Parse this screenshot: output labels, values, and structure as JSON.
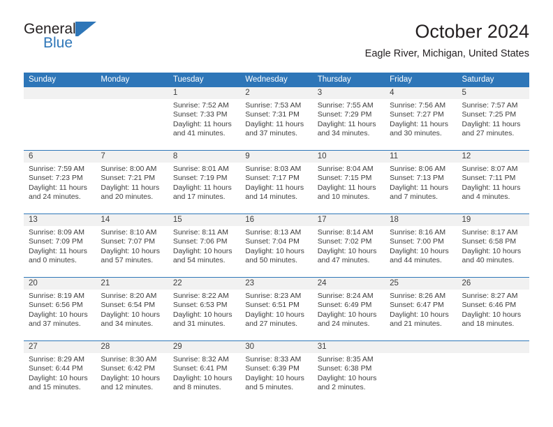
{
  "brand": {
    "word_general": "General",
    "word_blue": "Blue",
    "logo_color": "#2e76b8"
  },
  "header": {
    "month_title": "October 2024",
    "location": "Eagle River, Michigan, United States"
  },
  "theme": {
    "header_blue": "#2e76b8",
    "daynum_band": "#f1f1f1",
    "text": "#3d3d3d",
    "title_text": "#231f20"
  },
  "weekdays": [
    "Sunday",
    "Monday",
    "Tuesday",
    "Wednesday",
    "Thursday",
    "Friday",
    "Saturday"
  ],
  "labels": {
    "sunrise_prefix": "Sunrise:",
    "sunset_prefix": "Sunset:",
    "daylight_prefix": "Daylight:"
  },
  "weeks": [
    [
      {
        "day": "",
        "sunrise": "",
        "sunset": "",
        "daylight": "",
        "empty": true
      },
      {
        "day": "",
        "sunrise": "",
        "sunset": "",
        "daylight": "",
        "empty": true
      },
      {
        "day": "1",
        "sunrise": "Sunrise: 7:52 AM",
        "sunset": "Sunset: 7:33 PM",
        "daylight": "Daylight: 11 hours and 41 minutes.",
        "empty": false
      },
      {
        "day": "2",
        "sunrise": "Sunrise: 7:53 AM",
        "sunset": "Sunset: 7:31 PM",
        "daylight": "Daylight: 11 hours and 37 minutes.",
        "empty": false
      },
      {
        "day": "3",
        "sunrise": "Sunrise: 7:55 AM",
        "sunset": "Sunset: 7:29 PM",
        "daylight": "Daylight: 11 hours and 34 minutes.",
        "empty": false
      },
      {
        "day": "4",
        "sunrise": "Sunrise: 7:56 AM",
        "sunset": "Sunset: 7:27 PM",
        "daylight": "Daylight: 11 hours and 30 minutes.",
        "empty": false
      },
      {
        "day": "5",
        "sunrise": "Sunrise: 7:57 AM",
        "sunset": "Sunset: 7:25 PM",
        "daylight": "Daylight: 11 hours and 27 minutes.",
        "empty": false
      }
    ],
    [
      {
        "day": "6",
        "sunrise": "Sunrise: 7:59 AM",
        "sunset": "Sunset: 7:23 PM",
        "daylight": "Daylight: 11 hours and 24 minutes.",
        "empty": false
      },
      {
        "day": "7",
        "sunrise": "Sunrise: 8:00 AM",
        "sunset": "Sunset: 7:21 PM",
        "daylight": "Daylight: 11 hours and 20 minutes.",
        "empty": false
      },
      {
        "day": "8",
        "sunrise": "Sunrise: 8:01 AM",
        "sunset": "Sunset: 7:19 PM",
        "daylight": "Daylight: 11 hours and 17 minutes.",
        "empty": false
      },
      {
        "day": "9",
        "sunrise": "Sunrise: 8:03 AM",
        "sunset": "Sunset: 7:17 PM",
        "daylight": "Daylight: 11 hours and 14 minutes.",
        "empty": false
      },
      {
        "day": "10",
        "sunrise": "Sunrise: 8:04 AM",
        "sunset": "Sunset: 7:15 PM",
        "daylight": "Daylight: 11 hours and 10 minutes.",
        "empty": false
      },
      {
        "day": "11",
        "sunrise": "Sunrise: 8:06 AM",
        "sunset": "Sunset: 7:13 PM",
        "daylight": "Daylight: 11 hours and 7 minutes.",
        "empty": false
      },
      {
        "day": "12",
        "sunrise": "Sunrise: 8:07 AM",
        "sunset": "Sunset: 7:11 PM",
        "daylight": "Daylight: 11 hours and 4 minutes.",
        "empty": false
      }
    ],
    [
      {
        "day": "13",
        "sunrise": "Sunrise: 8:09 AM",
        "sunset": "Sunset: 7:09 PM",
        "daylight": "Daylight: 11 hours and 0 minutes.",
        "empty": false
      },
      {
        "day": "14",
        "sunrise": "Sunrise: 8:10 AM",
        "sunset": "Sunset: 7:07 PM",
        "daylight": "Daylight: 10 hours and 57 minutes.",
        "empty": false
      },
      {
        "day": "15",
        "sunrise": "Sunrise: 8:11 AM",
        "sunset": "Sunset: 7:06 PM",
        "daylight": "Daylight: 10 hours and 54 minutes.",
        "empty": false
      },
      {
        "day": "16",
        "sunrise": "Sunrise: 8:13 AM",
        "sunset": "Sunset: 7:04 PM",
        "daylight": "Daylight: 10 hours and 50 minutes.",
        "empty": false
      },
      {
        "day": "17",
        "sunrise": "Sunrise: 8:14 AM",
        "sunset": "Sunset: 7:02 PM",
        "daylight": "Daylight: 10 hours and 47 minutes.",
        "empty": false
      },
      {
        "day": "18",
        "sunrise": "Sunrise: 8:16 AM",
        "sunset": "Sunset: 7:00 PM",
        "daylight": "Daylight: 10 hours and 44 minutes.",
        "empty": false
      },
      {
        "day": "19",
        "sunrise": "Sunrise: 8:17 AM",
        "sunset": "Sunset: 6:58 PM",
        "daylight": "Daylight: 10 hours and 40 minutes.",
        "empty": false
      }
    ],
    [
      {
        "day": "20",
        "sunrise": "Sunrise: 8:19 AM",
        "sunset": "Sunset: 6:56 PM",
        "daylight": "Daylight: 10 hours and 37 minutes.",
        "empty": false
      },
      {
        "day": "21",
        "sunrise": "Sunrise: 8:20 AM",
        "sunset": "Sunset: 6:54 PM",
        "daylight": "Daylight: 10 hours and 34 minutes.",
        "empty": false
      },
      {
        "day": "22",
        "sunrise": "Sunrise: 8:22 AM",
        "sunset": "Sunset: 6:53 PM",
        "daylight": "Daylight: 10 hours and 31 minutes.",
        "empty": false
      },
      {
        "day": "23",
        "sunrise": "Sunrise: 8:23 AM",
        "sunset": "Sunset: 6:51 PM",
        "daylight": "Daylight: 10 hours and 27 minutes.",
        "empty": false
      },
      {
        "day": "24",
        "sunrise": "Sunrise: 8:24 AM",
        "sunset": "Sunset: 6:49 PM",
        "daylight": "Daylight: 10 hours and 24 minutes.",
        "empty": false
      },
      {
        "day": "25",
        "sunrise": "Sunrise: 8:26 AM",
        "sunset": "Sunset: 6:47 PM",
        "daylight": "Daylight: 10 hours and 21 minutes.",
        "empty": false
      },
      {
        "day": "26",
        "sunrise": "Sunrise: 8:27 AM",
        "sunset": "Sunset: 6:46 PM",
        "daylight": "Daylight: 10 hours and 18 minutes.",
        "empty": false
      }
    ],
    [
      {
        "day": "27",
        "sunrise": "Sunrise: 8:29 AM",
        "sunset": "Sunset: 6:44 PM",
        "daylight": "Daylight: 10 hours and 15 minutes.",
        "empty": false
      },
      {
        "day": "28",
        "sunrise": "Sunrise: 8:30 AM",
        "sunset": "Sunset: 6:42 PM",
        "daylight": "Daylight: 10 hours and 12 minutes.",
        "empty": false
      },
      {
        "day": "29",
        "sunrise": "Sunrise: 8:32 AM",
        "sunset": "Sunset: 6:41 PM",
        "daylight": "Daylight: 10 hours and 8 minutes.",
        "empty": false
      },
      {
        "day": "30",
        "sunrise": "Sunrise: 8:33 AM",
        "sunset": "Sunset: 6:39 PM",
        "daylight": "Daylight: 10 hours and 5 minutes.",
        "empty": false
      },
      {
        "day": "31",
        "sunrise": "Sunrise: 8:35 AM",
        "sunset": "Sunset: 6:38 PM",
        "daylight": "Daylight: 10 hours and 2 minutes.",
        "empty": false
      },
      {
        "day": "",
        "sunrise": "",
        "sunset": "",
        "daylight": "",
        "empty": true
      },
      {
        "day": "",
        "sunrise": "",
        "sunset": "",
        "daylight": "",
        "empty": true
      }
    ]
  ]
}
